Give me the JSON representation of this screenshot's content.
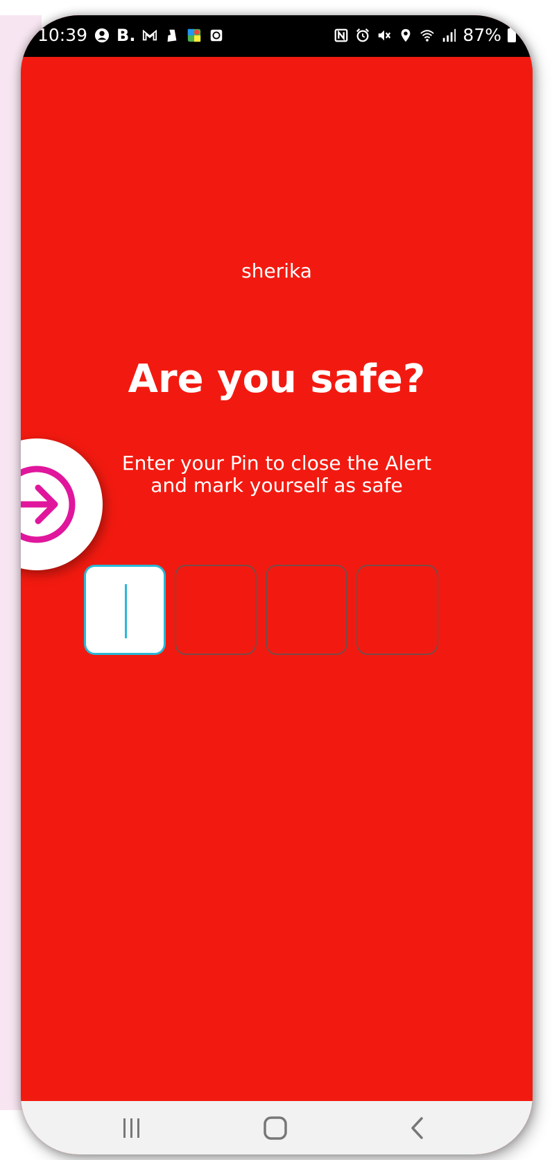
{
  "status_bar": {
    "time": "10:39",
    "left_icons": [
      "account-circle-icon",
      "booking-b-icon",
      "gmail-icon",
      "deliveroo-icon",
      "maps-icon",
      "clock-app-icon"
    ],
    "booking_label": "B.",
    "right_icons": [
      "nfc-icon",
      "alarm-icon",
      "mute-icon",
      "location-icon",
      "wifi-icon",
      "signal-icon",
      "battery-icon"
    ],
    "battery_percent": "87%"
  },
  "alert": {
    "username": "sherika",
    "heading": "Are you safe?",
    "instruction_line1": "Enter your Pin to close the Alert",
    "instruction_line2": "and mark yourself as safe",
    "pin_length": 4,
    "active_index": 0,
    "background_color": "#f21a10",
    "accent_color": "#2bb8d6"
  },
  "side_button": {
    "icon": "arrow-right-circle-icon",
    "color": "#e0169c"
  },
  "nav_bar": {
    "icons": [
      "recent-apps-icon",
      "home-icon",
      "back-icon"
    ]
  }
}
